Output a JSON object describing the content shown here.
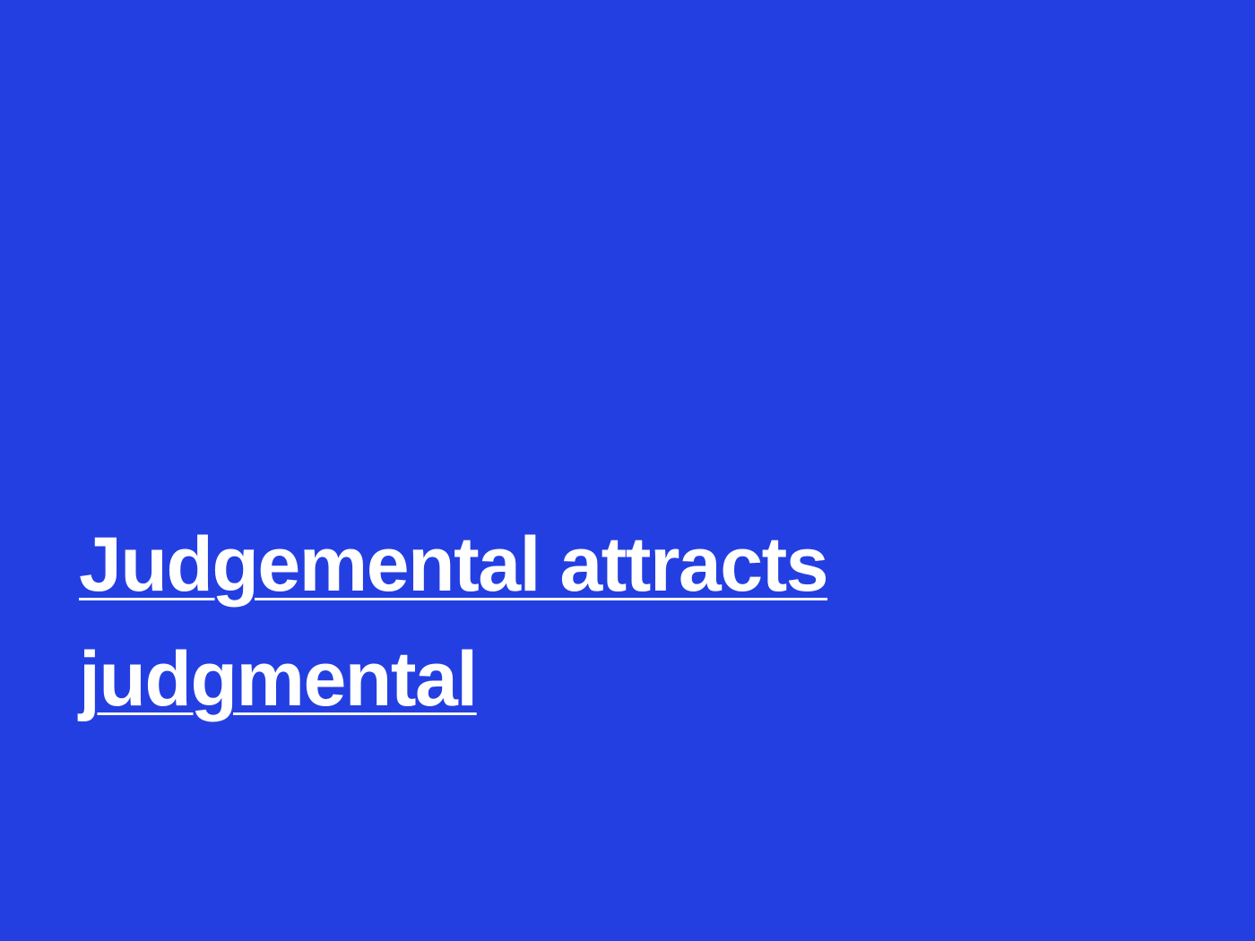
{
  "background_color": "#243fe1",
  "text_color": "#ffffff",
  "headline": {
    "line1": "Judgemental attracts",
    "line2": "judgmental"
  }
}
